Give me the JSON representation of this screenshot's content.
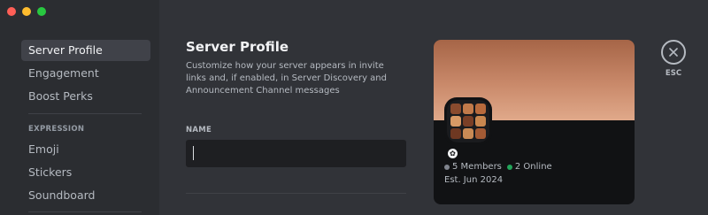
{
  "sidebar": {
    "items": [
      {
        "label": "Server Profile",
        "active": true
      },
      {
        "label": "Engagement"
      },
      {
        "label": "Boost Perks"
      }
    ],
    "section_header": "EXPRESSION",
    "expression_items": [
      {
        "label": "Emoji"
      },
      {
        "label": "Stickers"
      },
      {
        "label": "Soundboard"
      }
    ]
  },
  "main": {
    "title": "Server Profile",
    "description": "Customize how your server appears in invite links and, if enabled, in Server Discovery and Announcement Channel messages",
    "name_field": {
      "label": "NAME",
      "value": ""
    }
  },
  "preview": {
    "members": "5 Members",
    "online": "2 Online",
    "established": "Est. Jun 2024",
    "banner_color": "#c9896a",
    "online_color": "#23a55a"
  },
  "close": {
    "label": "ESC",
    "icon": "close-icon"
  },
  "window_controls": [
    "close",
    "minimize",
    "maximize"
  ]
}
